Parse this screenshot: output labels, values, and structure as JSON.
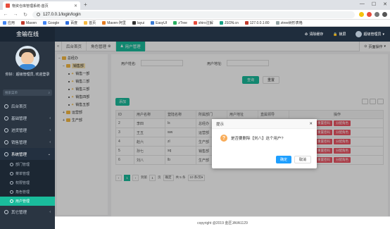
{
  "browser": {
    "tab_title": "物资仓库管理系统-首页",
    "url": "127.0.0.1/login/login",
    "bookmarks": [
      "应用",
      "Maven",
      "Google",
      "百度",
      "首页",
      "Maven-阿里",
      "layui",
      "EasyUI",
      "zTree",
      "shiro注解",
      "JSON.cn",
      "127.0.0.1:80",
      "ztree树形表格"
    ]
  },
  "app": {
    "brand": "金输在线",
    "top_right": {
      "clear": "清除缓存",
      "lock": "锁屏",
      "user": "超级管理员"
    },
    "welcome": "你好：超级管理员, 欢迎登录",
    "side_search_placeholder": "搜索菜单",
    "menu": [
      {
        "label": "后台首页"
      },
      {
        "label": "基础管理"
      },
      {
        "label": "进货管理"
      },
      {
        "label": "销售管理"
      },
      {
        "label": "系统管理"
      }
    ],
    "submenu": [
      "部门管理",
      "菜单管理",
      "权限管理",
      "角色管理",
      "用户管理"
    ],
    "menu_last": "其它管理"
  },
  "page_tabs": [
    "后台首页",
    "角色管理",
    "用户管理"
  ],
  "page_ops": "页面操作",
  "tree": {
    "root": "总经办",
    "sel": "销售部",
    "children": [
      "销售一部",
      "销售二部",
      "销售三部",
      "销售四部",
      "销售五部"
    ],
    "others": [
      "运营部",
      "生产部"
    ]
  },
  "form": {
    "username_label": "用户姓名:",
    "address_label": "用户地址:",
    "search": "查询",
    "reset": "重置"
  },
  "table": {
    "add": "添加",
    "headers": [
      "ID",
      "用户名称",
      "登陆名称",
      "所属部门",
      "用户地址",
      "直属领导",
      "操作"
    ],
    "rows": [
      [
        "2",
        "李四",
        "ls",
        "总经办",
        "武汉",
        "张三"
      ],
      [
        "3",
        "王五",
        "ww",
        "运营部",
        "",
        "张三"
      ],
      [
        "4",
        "赵六",
        "zl",
        "生产部",
        "",
        "王五"
      ],
      [
        "5",
        "孙七",
        "sq",
        "销售部",
        "",
        "王五"
      ],
      [
        "6",
        "刘八",
        "lb",
        "生产部",
        "深圳",
        "王五"
      ]
    ],
    "ops": {
      "edit": "修改",
      "delete": "删除",
      "reset": "重置密码",
      "role": "分配角色"
    }
  },
  "pager": {
    "current": "1",
    "goto": "到第",
    "page": "1",
    "page_unit": "页",
    "confirm": "确定",
    "total": "共 5 条",
    "size": "10 条/页"
  },
  "footer": "copyright @2019 金匠JAVA1129",
  "dialog": {
    "title": "提示",
    "message": "是否要删除【刘八】这个用户?",
    "ok": "确定",
    "cancel": "取消"
  }
}
